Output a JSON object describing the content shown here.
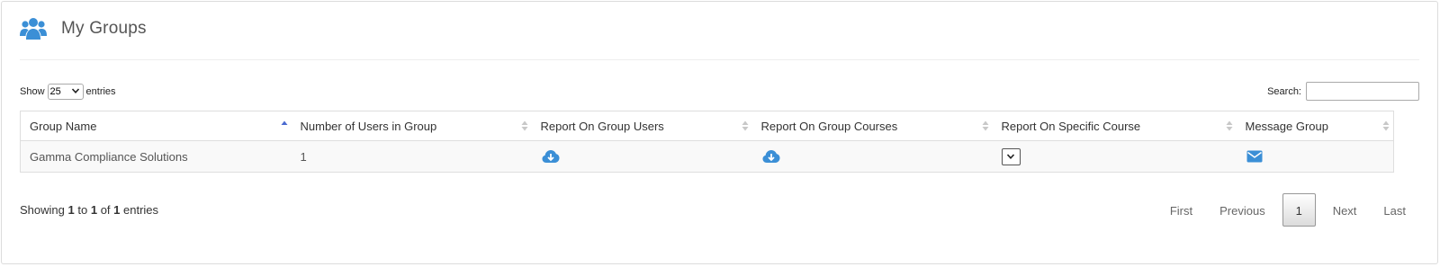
{
  "page": {
    "title": "My Groups",
    "icon": "users-icon"
  },
  "length": {
    "prefix": "Show",
    "value": "25",
    "suffix": "entries"
  },
  "search": {
    "label": "Search:",
    "value": "",
    "placeholder": ""
  },
  "table": {
    "columns": [
      {
        "label": "Group Name",
        "sort": "ascending"
      },
      {
        "label": "Number of Users in Group",
        "sort": "none"
      },
      {
        "label": "Report On Group Users",
        "sort": "none"
      },
      {
        "label": "Report On Group Courses",
        "sort": "none"
      },
      {
        "label": "Report On Specific Course",
        "sort": "none"
      },
      {
        "label": "Message Group",
        "sort": "none"
      }
    ],
    "rows": [
      {
        "group_name": "Gamma Compliance Solutions",
        "users": "1",
        "report_users_icon": "cloud-download-icon",
        "report_courses_icon": "cloud-download-icon",
        "course_select_icon": "chevron-down-icon",
        "message_icon": "envelope-icon"
      }
    ]
  },
  "info": {
    "prefix": "Showing",
    "start": "1",
    "to": "to",
    "end": "1",
    "of": "of",
    "total": "1",
    "suffix": "entries"
  },
  "pagination": {
    "first": "First",
    "previous": "Previous",
    "current": "1",
    "next": "Next",
    "last": "Last"
  },
  "colors": {
    "accent": "#3b8fd6",
    "sort_active": "#4a6ad0",
    "sort_inactive": "#c8c8c8"
  }
}
